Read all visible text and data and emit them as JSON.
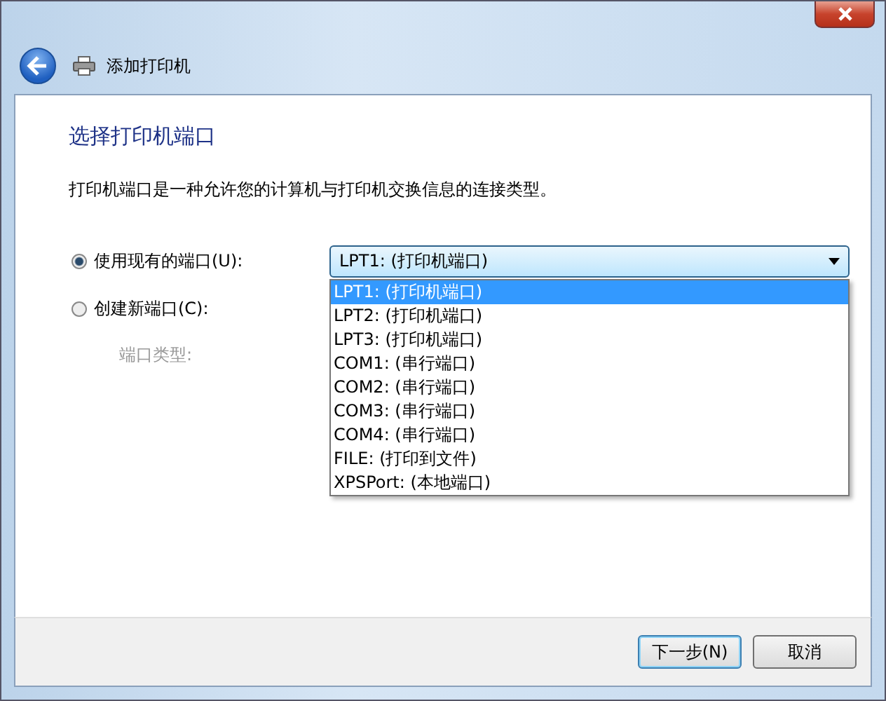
{
  "window": {
    "title": "添加打印机"
  },
  "heading": "选择打印机端口",
  "description": "打印机端口是一种允许您的计算机与打印机交换信息的连接类型。",
  "options": [
    {
      "label": "使用现有的端口(U):",
      "selected": true
    },
    {
      "label": "创建新端口(C):",
      "selected": false
    }
  ],
  "port_type": {
    "label": "端口类型:",
    "disabled": true
  },
  "port_dropdown": {
    "value": "LPT1: (打印机端口)",
    "expanded": true,
    "items": [
      {
        "label": "LPT1: (打印机端口)",
        "selected": true
      },
      {
        "label": "LPT2: (打印机端口)",
        "selected": false
      },
      {
        "label": "LPT3: (打印机端口)",
        "selected": false
      },
      {
        "label": "COM1: (串行端口)",
        "selected": false
      },
      {
        "label": "COM2: (串行端口)",
        "selected": false
      },
      {
        "label": "COM3: (串行端口)",
        "selected": false
      },
      {
        "label": "COM4: (串行端口)",
        "selected": false
      },
      {
        "label": "FILE: (打印到文件)",
        "selected": false
      },
      {
        "label": "XPSPort: (本地端口)",
        "selected": false
      }
    ]
  },
  "buttons": [
    "下一步(N)",
    "取消"
  ]
}
